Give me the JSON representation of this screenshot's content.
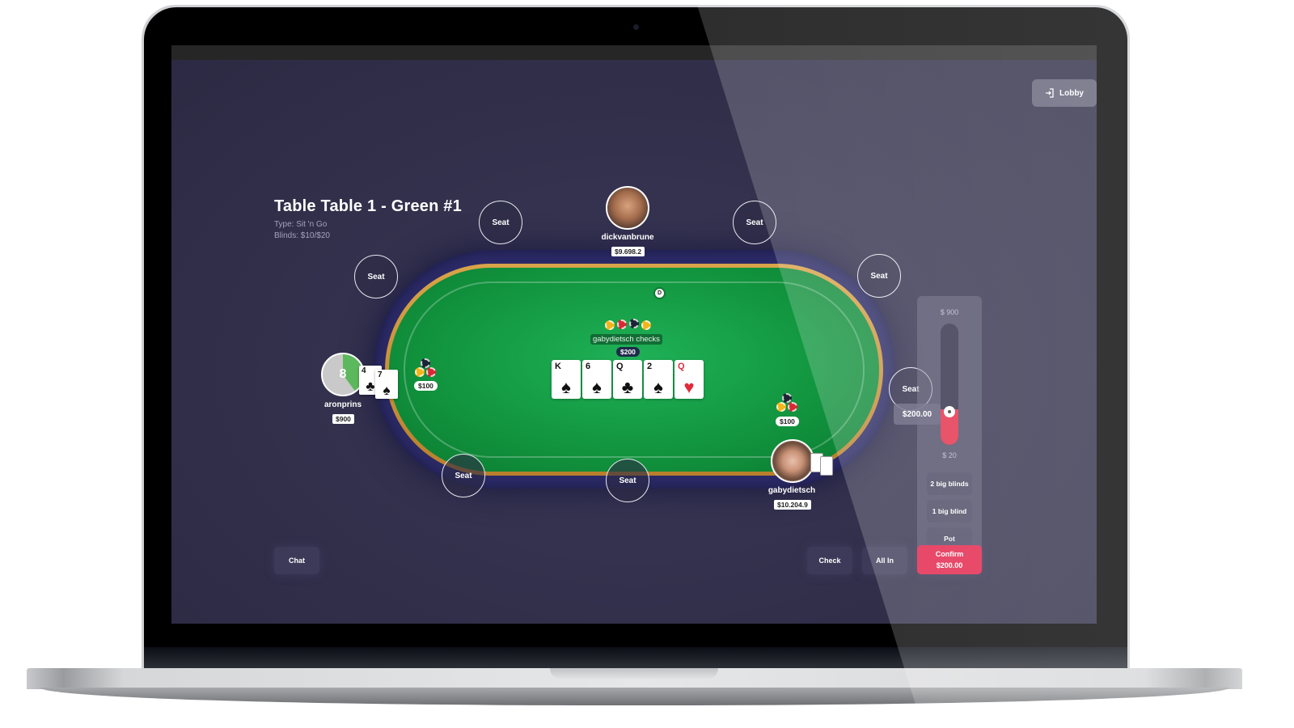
{
  "header": {
    "title": "Table Table 1 - Green #1",
    "type_line": "Type: Sit 'n Go",
    "blinds_line": "Blinds: $10/$20"
  },
  "lobby_button": {
    "label": "Lobby",
    "icon": "sign-in-icon"
  },
  "seats": [
    {
      "label": "Seat"
    },
    {
      "label": "Seat"
    },
    {
      "label": "Seat"
    },
    {
      "label": "Seat"
    },
    {
      "label": "Seat"
    },
    {
      "label": "Seat"
    },
    {
      "label": "Seat"
    }
  ],
  "players": {
    "top": {
      "name": "dickvanbrune",
      "stack": "$9.698.2"
    },
    "left": {
      "name": "aronprins",
      "stack": "$900",
      "timer_value": "8",
      "timer_progress": 0.4,
      "hole_cards": [
        {
          "rank": "4",
          "suit": "♣"
        },
        {
          "rank": "7",
          "suit": "♠"
        }
      ],
      "bet": "$100"
    },
    "bottom_right": {
      "name": "gabydietsch",
      "stack": "$10.204.9",
      "bet": "$100"
    }
  },
  "dealer_button": "D",
  "last_action": "gabydietsch checks",
  "pot": "$200",
  "community_cards": [
    {
      "rank": "K",
      "suit": "♠",
      "color": "black"
    },
    {
      "rank": "6",
      "suit": "♠",
      "color": "black"
    },
    {
      "rank": "Q",
      "suit": "♣",
      "color": "black"
    },
    {
      "rank": "2",
      "suit": "♠",
      "color": "black"
    },
    {
      "rank": "Q",
      "suit": "♥",
      "color": "red"
    }
  ],
  "raise": {
    "max_label": "$ 900",
    "min_label": "$ 20",
    "current_value": "$200.00",
    "slider_fraction": 0.2,
    "presets": [
      "2 big blinds",
      "1 big blind",
      "Pot"
    ]
  },
  "actions": {
    "chat": "Chat",
    "check": "Check",
    "all_in": "All In",
    "confirm": "Confirm",
    "confirm_amount": "$200.00"
  },
  "colors": {
    "background": "#312f4a",
    "felt": "#12963f",
    "accent_red": "#e31d45"
  }
}
